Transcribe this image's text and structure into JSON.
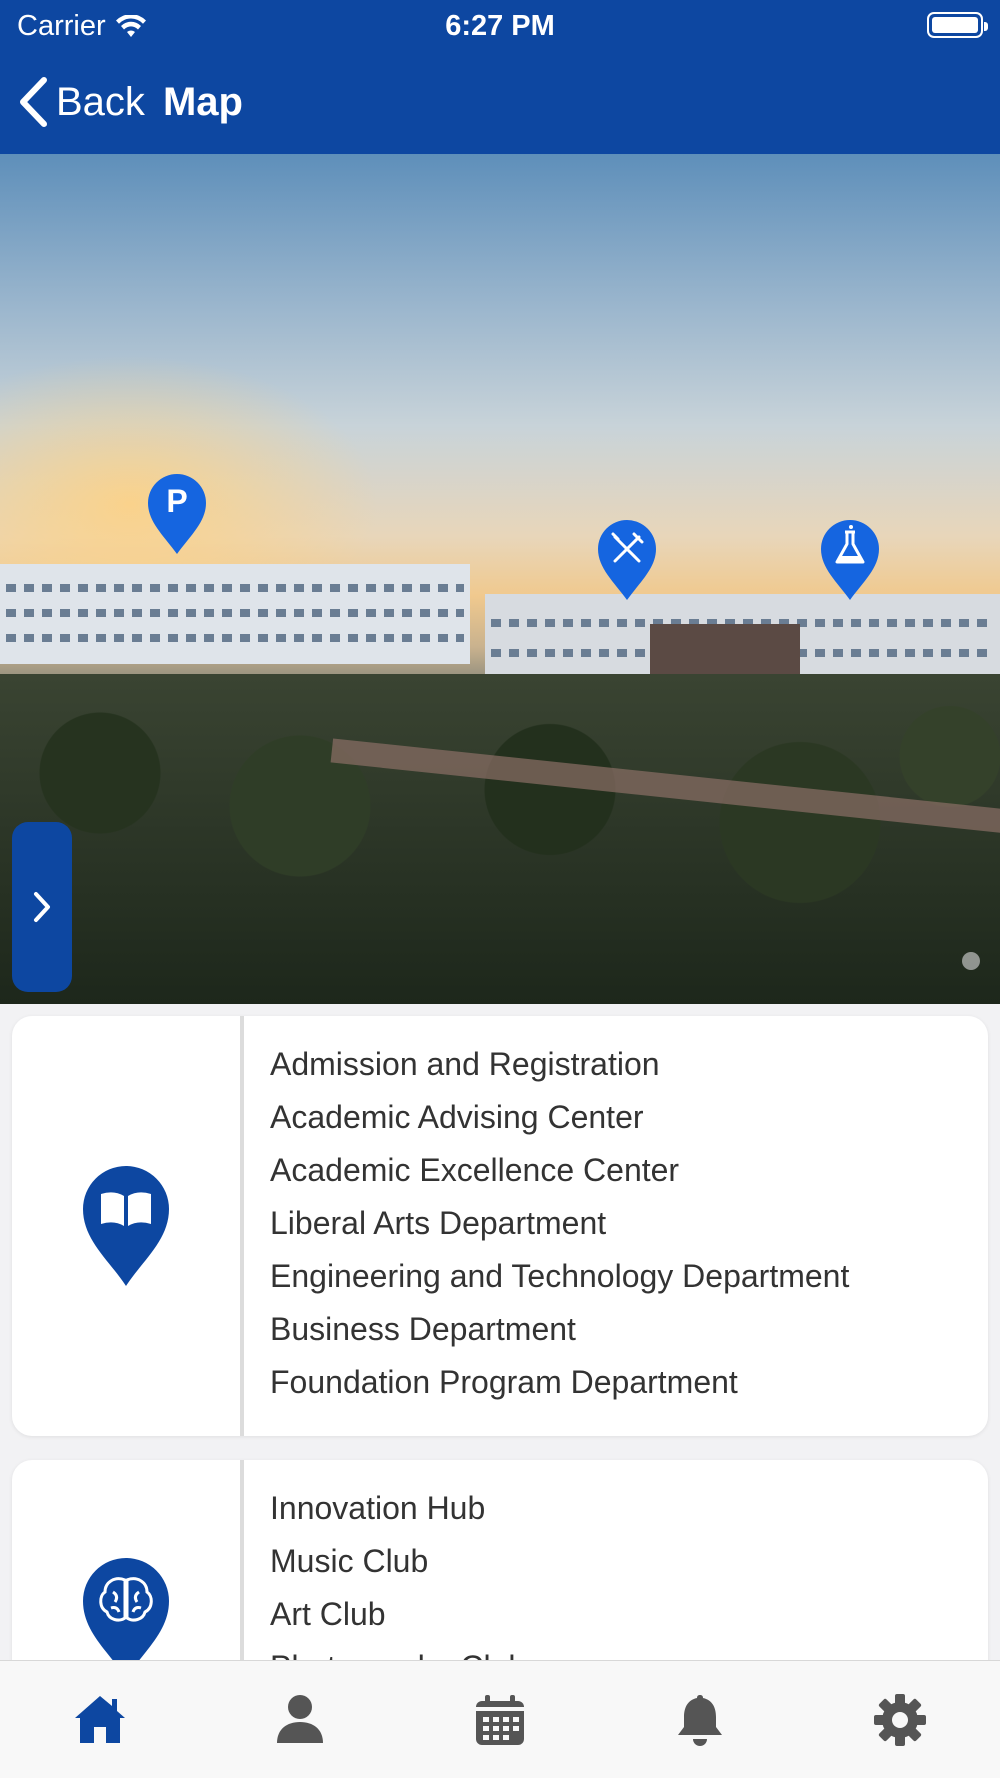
{
  "status_bar": {
    "carrier": "Carrier",
    "time": "6:27 PM"
  },
  "nav": {
    "back_label": "Back",
    "title": "Map"
  },
  "map": {
    "markers": [
      {
        "name": "parking",
        "label": "P"
      },
      {
        "name": "dining",
        "icon": "fork-knife-icon"
      },
      {
        "name": "lab",
        "icon": "flask-icon"
      }
    ]
  },
  "cards": [
    {
      "icon": "book-marker-icon",
      "items": [
        "Admission and Registration",
        "Academic Advising Center",
        "Academic Excellence Center",
        "Liberal Arts Department",
        "Engineering and Technology Department",
        "Business Department",
        "Foundation Program Department"
      ]
    },
    {
      "icon": "brain-marker-icon",
      "items": [
        "Innovation Hub",
        "Music Club",
        "Art Club",
        "Photography Club"
      ]
    }
  ],
  "tabs": [
    "home-icon",
    "person-icon",
    "calendar-icon",
    "bell-icon",
    "gear-icon"
  ],
  "colors": {
    "primary": "#0d47a1",
    "tab_active": "#0d47a1",
    "tab_inactive": "#555555",
    "marker": "#1565e0"
  }
}
